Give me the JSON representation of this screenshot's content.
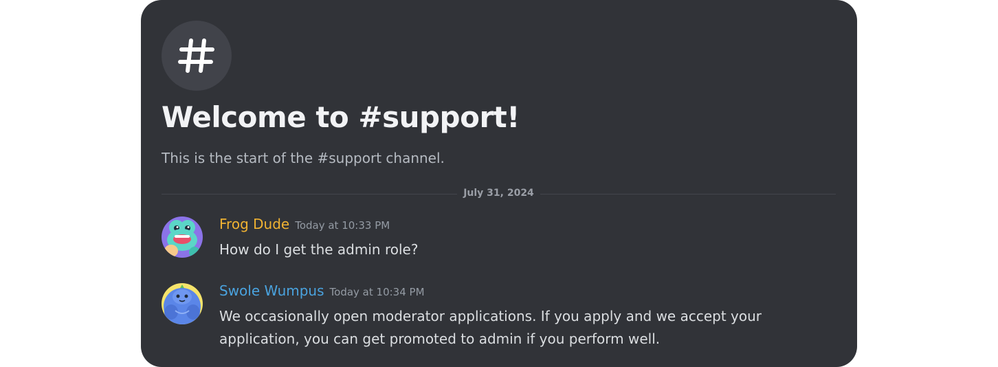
{
  "channel": {
    "icon": "hash-icon",
    "title": "Welcome to #support!",
    "subtitle": "This is the start of the #support channel."
  },
  "divider": {
    "date": "July 31, 2024"
  },
  "messages": [
    {
      "author": "Frog Dude",
      "author_color": "#f0b232",
      "timestamp": "Today at 10:33 PM",
      "avatar": "frog-avatar",
      "text": "How do I get the admin role?"
    },
    {
      "author": "Swole Wumpus",
      "author_color": "#4aa3df",
      "timestamp": "Today at 10:34 PM",
      "avatar": "wumpus-avatar",
      "text": "We occasionally open moderator applications. If you apply and we accept your application, you can get promoted to admin if you perform well."
    }
  ],
  "colors": {
    "background": "#313338",
    "icon_circle": "#41434a",
    "title": "#f2f3f5",
    "body_text": "#dbdee1",
    "muted_text": "#b5bac1"
  }
}
